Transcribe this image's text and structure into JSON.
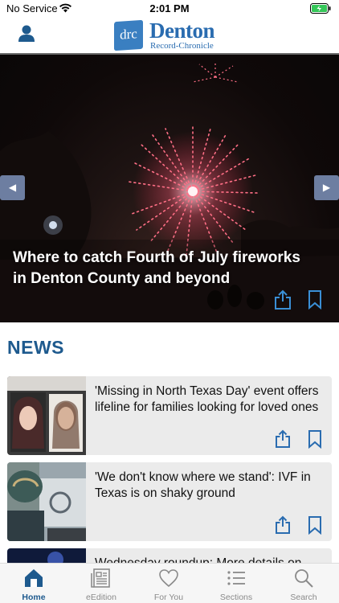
{
  "status_bar": {
    "carrier": "No Service",
    "time": "2:01 PM"
  },
  "header": {
    "logo_mark": "drc",
    "logo_name": "Denton",
    "logo_sub": "Record-Chronicle"
  },
  "hero": {
    "title": "Where to catch Fourth of July fireworks in Denton County and beyond"
  },
  "news": {
    "section_title": "NEWS",
    "items": [
      {
        "headline": "'Missing in North Texas Day' event offers lifeline for families looking for loved ones"
      },
      {
        "headline": "'We don't know where we stand': IVF in Texas is on shaky ground"
      },
      {
        "headline": "Wednesday roundup: More details on"
      }
    ]
  },
  "tabbar": {
    "tabs": [
      {
        "label": "Home",
        "icon": "home-icon"
      },
      {
        "label": "eEdition",
        "icon": "newspaper-icon"
      },
      {
        "label": "For You",
        "icon": "heart-icon"
      },
      {
        "label": "Sections",
        "icon": "list-icon"
      },
      {
        "label": "Search",
        "icon": "search-icon"
      }
    ]
  },
  "colors": {
    "brand": "#1e5a8e",
    "logo_blue": "#2a6cb0",
    "arrow": "#6d7ea1",
    "card_bg": "#ebebeb"
  }
}
